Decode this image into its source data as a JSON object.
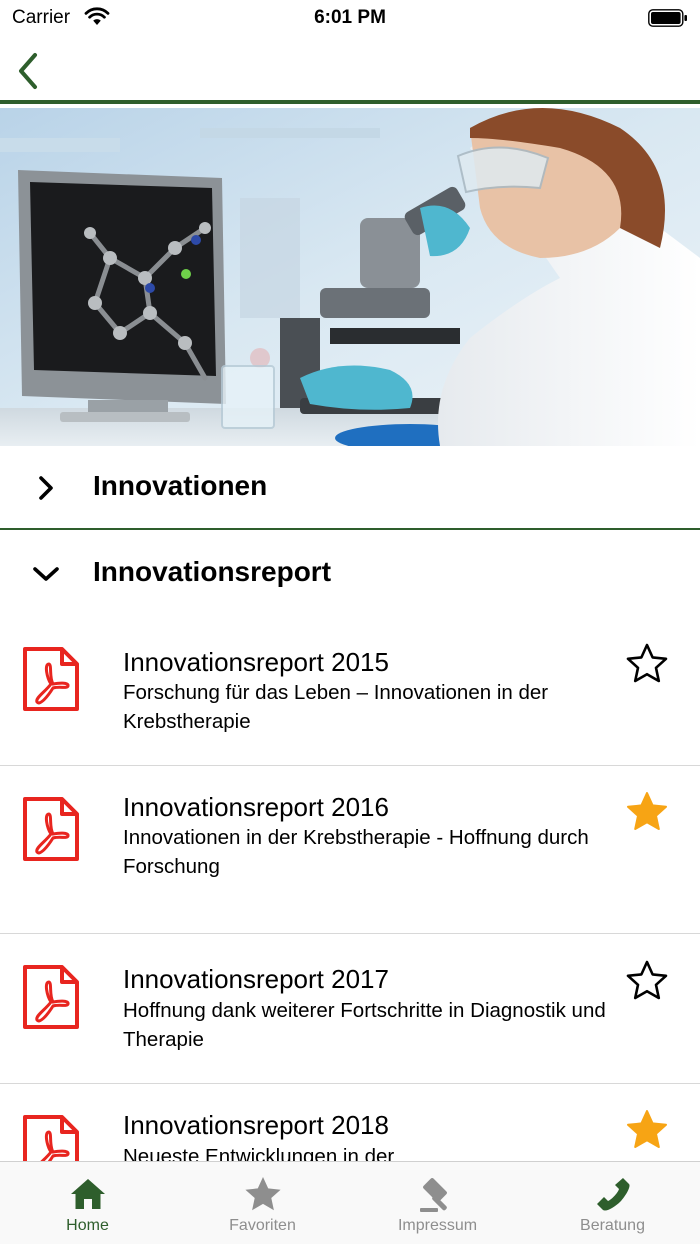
{
  "status_bar": {
    "carrier": "Carrier",
    "time": "6:01 PM"
  },
  "colors": {
    "accent": "#2e5e2c",
    "pdf_red": "#e8251f",
    "star_orange": "#f7a414",
    "tab_inactive": "#8e8e8e"
  },
  "nav": {
    "back_icon": "chevron-left-icon"
  },
  "sections": [
    {
      "title": "Innovationen",
      "expanded": false
    },
    {
      "title": "Innovationsreport",
      "expanded": true
    }
  ],
  "reports": [
    {
      "title": "Innovationsreport 2015",
      "subtitle": "Forschung für das Leben – Innovationen in der Krebstherapie",
      "favorite": false
    },
    {
      "title": "Innovationsreport 2016",
      "subtitle": "Innovationen in der Krebstherapie - Hoffnung durch Forschung",
      "favorite": true
    },
    {
      "title": "Innovationsreport 2017",
      "subtitle": "Hoffnung dank weiterer Fortschritte in Diagnostik und Therapie",
      "favorite": false
    },
    {
      "title": "Innovationsreport 2018",
      "subtitle": "Neueste Entwicklungen in der",
      "favorite": true
    }
  ],
  "tabs": [
    {
      "label": "Home",
      "icon": "home-icon",
      "active": true
    },
    {
      "label": "Favoriten",
      "icon": "star-icon",
      "active": false
    },
    {
      "label": "Impressum",
      "icon": "gavel-icon",
      "active": false
    },
    {
      "label": "Beratung",
      "icon": "phone-icon",
      "active": false
    }
  ]
}
